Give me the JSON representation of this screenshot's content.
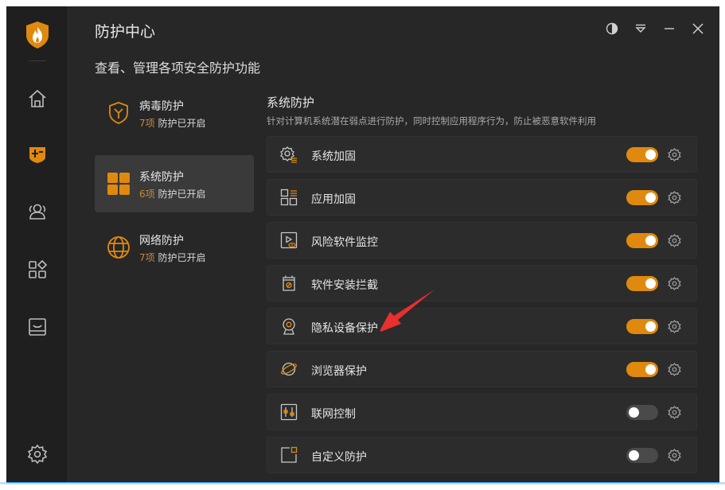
{
  "header": {
    "title": "防护中心",
    "subtitle": "查看、管理各项安全防护功能"
  },
  "rail": {
    "items": [
      {
        "icon": "home-icon"
      },
      {
        "icon": "protection-center-icon",
        "active": true
      },
      {
        "icon": "users-icon"
      },
      {
        "icon": "apps-icon"
      },
      {
        "icon": "inbox-icon"
      },
      {
        "icon": "settings-icon"
      }
    ]
  },
  "categories": [
    {
      "name": "病毒防护",
      "count": "7项",
      "status": "防护已开启",
      "icon": "virus-shield-icon",
      "active": false
    },
    {
      "name": "系统防护",
      "count": "6项",
      "status": "防护已开启",
      "icon": "system-grid-icon",
      "active": true
    },
    {
      "name": "网络防护",
      "count": "7项",
      "status": "防护已开启",
      "icon": "globe-icon",
      "active": false
    }
  ],
  "section": {
    "title": "系统防护",
    "description": "针对计算机系统潜在弱点进行防护，同时控制应用程序行为，防止被恶意软件利用"
  },
  "items": [
    {
      "label": "系统加固",
      "icon": "system-hardening-icon",
      "enabled": true
    },
    {
      "label": "应用加固",
      "icon": "app-hardening-icon",
      "enabled": true
    },
    {
      "label": "风险软件监控",
      "icon": "risk-software-icon",
      "enabled": true
    },
    {
      "label": "软件安装拦截",
      "icon": "install-block-icon",
      "enabled": true
    },
    {
      "label": "隐私设备保护",
      "icon": "webcam-icon",
      "enabled": true
    },
    {
      "label": "浏览器保护",
      "icon": "browser-icon",
      "enabled": true
    },
    {
      "label": "联网控制",
      "icon": "network-control-icon",
      "enabled": false
    },
    {
      "label": "自定义防护",
      "icon": "custom-protection-icon",
      "enabled": false
    }
  ],
  "colors": {
    "accent": "#e0890f",
    "background": "#272727",
    "rail": "#1f1f1f",
    "annotation_arrow": "#e8302f"
  }
}
